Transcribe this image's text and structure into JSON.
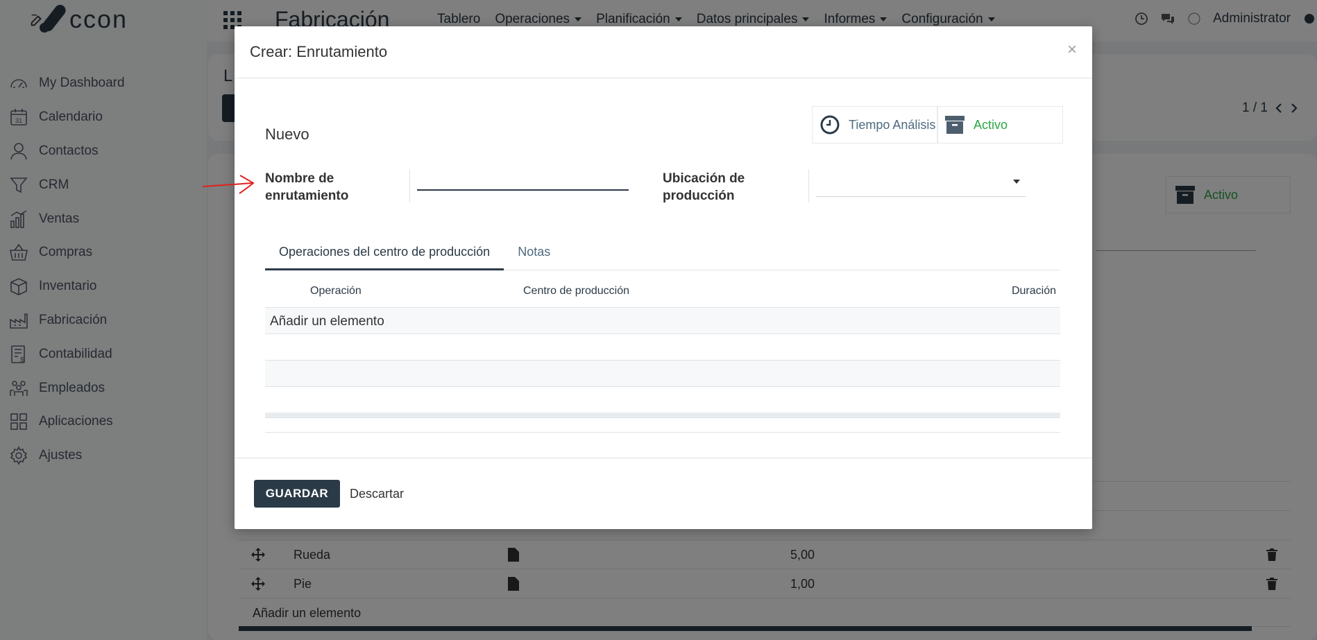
{
  "sidebar": {
    "logo_text": "ccon",
    "items": [
      {
        "label": "My Dashboard",
        "icon": "dashboard-icon"
      },
      {
        "label": "Calendario",
        "icon": "calendar-icon"
      },
      {
        "label": "Contactos",
        "icon": "person-icon"
      },
      {
        "label": "CRM",
        "icon": "filter-icon"
      },
      {
        "label": "Ventas",
        "icon": "bar-chart-icon"
      },
      {
        "label": "Compras",
        "icon": "basket-icon"
      },
      {
        "label": "Inventario",
        "icon": "box-icon"
      },
      {
        "label": "Fabricación",
        "icon": "factory-icon"
      },
      {
        "label": "Contabilidad",
        "icon": "accounting-icon"
      },
      {
        "label": "Empleados",
        "icon": "people-icon"
      },
      {
        "label": "Aplicaciones",
        "icon": "apps-grid-icon"
      },
      {
        "label": "Ajustes",
        "icon": "gear-icon"
      }
    ]
  },
  "topbar": {
    "app_title": "Fabricación",
    "menu": [
      "Tablero",
      "Operaciones",
      "Planificación",
      "Datos principales",
      "Informes",
      "Configuración"
    ],
    "user": "Administrator"
  },
  "background": {
    "title_initial": "L",
    "pager": "1 / 1",
    "active_label": "Activo",
    "rows": [
      {
        "name": "Rueda",
        "qty": "5,00"
      },
      {
        "name": "Pie",
        "qty": "1,00"
      }
    ],
    "add_line": "Añadir un elemento"
  },
  "modal": {
    "title": "Crear: Enrutamiento",
    "close": "×",
    "status": "Nuevo",
    "stat_time": "Tiempo Análisis",
    "stat_active": "Activo",
    "field_name_label": "Nombre de enrutamiento",
    "field_name_value": "",
    "field_location_label": "Ubicación de producción",
    "field_location_value": "",
    "tabs": [
      "Operaciones del centro de producción",
      "Notas"
    ],
    "columns": [
      "Operación",
      "Centro de producción",
      "Duración"
    ],
    "add_line": "Añadir un elemento",
    "save_label": "GUARDAR",
    "discard_label": "Descartar"
  },
  "colors": {
    "primary": "#2b3a47",
    "active_green": "#28a745",
    "annotation_red": "#e02020"
  }
}
